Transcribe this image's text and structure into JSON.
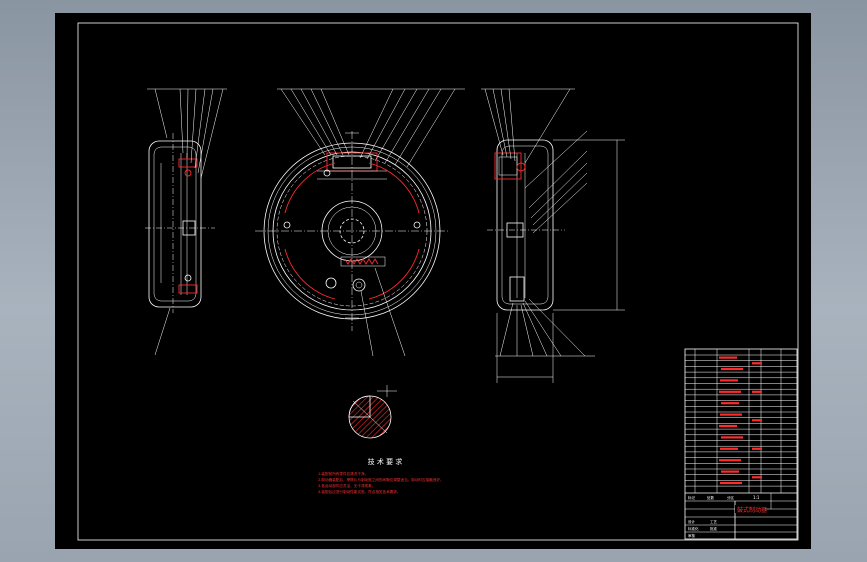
{
  "sheet": {
    "technical_requirements_title": "技 术 要 求",
    "notes": [
      "1.装配前所有零件应清洗干净。",
      "2.制动器装配后，摩擦片与制动鼓之间的间隙应调整适当，制动时应接触良好。",
      "3.各运动部件应灵活，无卡滞现象。",
      "4.装配后应进行制动性能试验，符合相关技术要求。"
    ]
  },
  "title_block": {
    "title": "鼓式制动器",
    "scale": "1:1",
    "cells": [
      "标记",
      "处数",
      "分区",
      "更改文件号",
      "签名",
      "年月日",
      "设计",
      "标准化",
      "审核",
      "工艺",
      "批准"
    ]
  },
  "icons": {
    "section_view": "hatched-circle-section",
    "front_view": "brake-drum-front",
    "side_views": "brake-drum-side"
  }
}
